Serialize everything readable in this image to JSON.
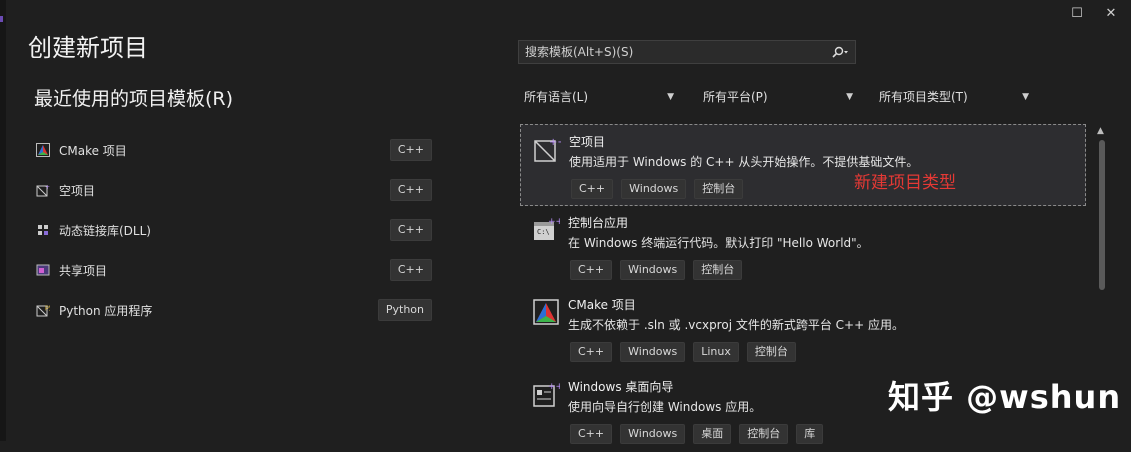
{
  "dialog": {
    "title": "创建新项目",
    "window_controls": {
      "maximize": "☐",
      "close": "✕"
    }
  },
  "recent": {
    "heading": "最近使用的项目模板(R)",
    "items": [
      {
        "label": "CMake 项目",
        "tag": "C++",
        "icon": "cmake-icon"
      },
      {
        "label": "空项目",
        "tag": "C++",
        "icon": "empty-project-icon"
      },
      {
        "label": "动态链接库(DLL)",
        "tag": "C++",
        "icon": "dll-icon"
      },
      {
        "label": "共享项目",
        "tag": "C++",
        "icon": "shared-project-icon"
      },
      {
        "label": "Python 应用程序",
        "tag": "Python",
        "icon": "python-app-icon"
      }
    ]
  },
  "search": {
    "placeholder": "搜索模板(Alt+S)(S)"
  },
  "filters": {
    "language": "所有语言(L)",
    "platform": "所有平台(P)",
    "project_type": "所有项目类型(T)"
  },
  "templates": [
    {
      "name": "空项目",
      "description": "使用适用于 Windows 的 C++ 从头开始操作。不提供基础文件。",
      "tags": [
        "C++",
        "Windows",
        "控制台"
      ],
      "icon": "empty-project-icon",
      "selected": true
    },
    {
      "name": "控制台应用",
      "description": "在 Windows 终端运行代码。默认打印 \"Hello World\"。",
      "tags": [
        "C++",
        "Windows",
        "控制台"
      ],
      "icon": "console-app-icon",
      "selected": false
    },
    {
      "name": "CMake 项目",
      "description": "生成不依赖于 .sln 或 .vcxproj 文件的新式跨平台 C++ 应用。",
      "tags": [
        "C++",
        "Windows",
        "Linux",
        "控制台"
      ],
      "icon": "cmake-icon",
      "selected": false
    },
    {
      "name": "Windows 桌面向导",
      "description": "使用向导自行创建 Windows 应用。",
      "tags": [
        "C++",
        "Windows",
        "桌面",
        "控制台",
        "库"
      ],
      "icon": "desktop-wizard-icon",
      "selected": false
    }
  ],
  "annotation": "新建项目类型",
  "watermark": "知乎 @wshun",
  "colors": {
    "background": "#1f1f1f",
    "annotation": "#e53935",
    "accent": "#6b4bb3"
  }
}
